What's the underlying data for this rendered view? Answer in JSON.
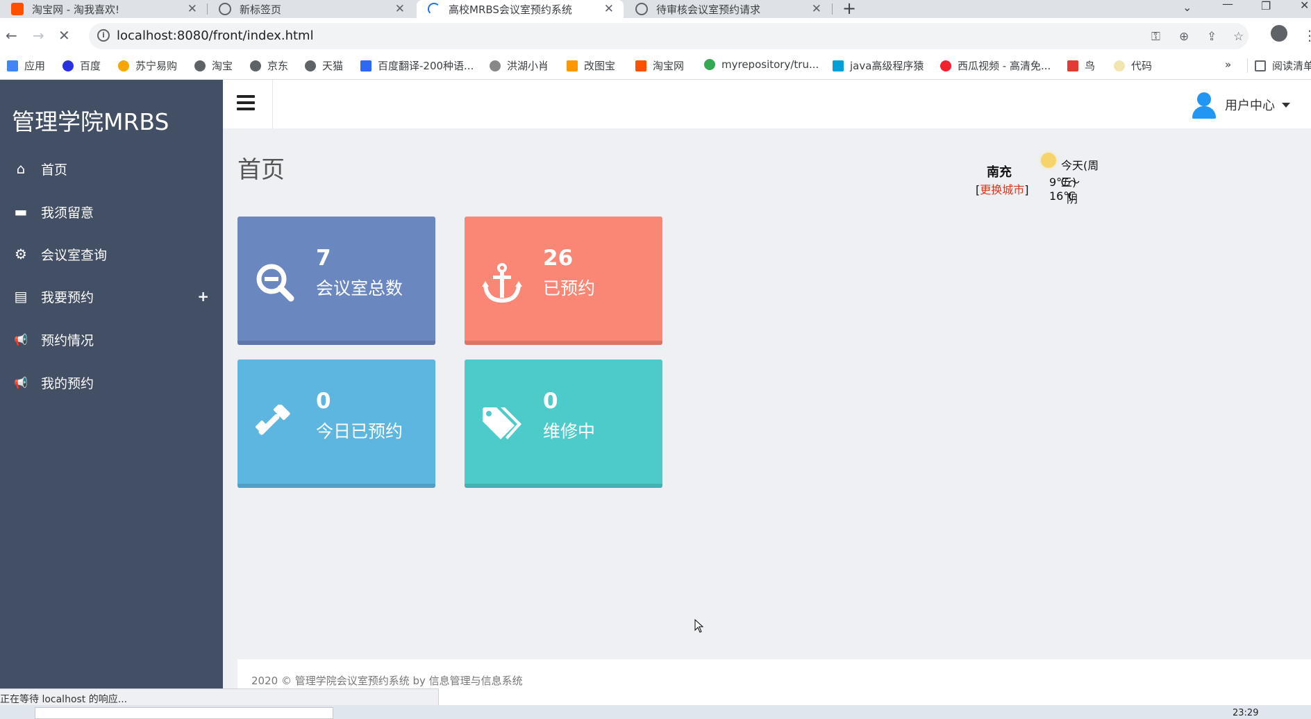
{
  "browser": {
    "tabs": [
      {
        "title": "淘宝网 - 淘我喜欢!",
        "active": false
      },
      {
        "title": "新标签页",
        "active": false
      },
      {
        "title": "高校MRBS会议室预约系统",
        "active": true
      },
      {
        "title": "待审核会议室预约请求",
        "active": false
      }
    ],
    "url": "localhost:8080/front/index.html",
    "bookmarks": [
      {
        "label": "应用",
        "color": "#4285f4"
      },
      {
        "label": "百度",
        "color": "#2932e1"
      },
      {
        "label": "苏宁易购",
        "color": "#f7a600"
      },
      {
        "label": "淘宝",
        "color": "#5f6368"
      },
      {
        "label": "京东",
        "color": "#5f6368"
      },
      {
        "label": "天猫",
        "color": "#5f6368"
      },
      {
        "label": "百度翻译-200种语...",
        "color": "#2a6bf2"
      },
      {
        "label": "洪湖小肖",
        "color": "#888888"
      },
      {
        "label": "改图宝",
        "color": "#ff9800"
      },
      {
        "label": "淘宝网",
        "color": "#ff5000"
      },
      {
        "label": "myrepository/tru...",
        "color": "#34a853"
      },
      {
        "label": "java高级程序猿",
        "color": "#00a1d6"
      },
      {
        "label": "西瓜视频 - 高清免...",
        "color": "#f5222d"
      },
      {
        "label": "鸟",
        "color": "#e53935"
      },
      {
        "label": "代码",
        "color": "#f2e6b0"
      }
    ],
    "bookmarks_more": "»",
    "reading_list": "阅读清单",
    "status_text": "正在等待 localhost 的响应..."
  },
  "sidebar": {
    "brand": "管理学院MRBS",
    "items": [
      {
        "label": "首页",
        "icon": "home-icon",
        "glyph": "⌂"
      },
      {
        "label": "我须留意",
        "icon": "archive-icon",
        "glyph": "▬"
      },
      {
        "label": "会议室查询",
        "icon": "gears-icon",
        "glyph": "⚙"
      },
      {
        "label": "我要预约",
        "icon": "file-icon",
        "glyph": "▤",
        "expand": "+"
      },
      {
        "label": "预约情况",
        "icon": "bullhorn-icon",
        "glyph": "📢"
      },
      {
        "label": "我的预约",
        "icon": "bullhorn-icon",
        "glyph": "📢"
      }
    ]
  },
  "topbar": {
    "user_center": "用户中心"
  },
  "main": {
    "title": "首页",
    "weather": {
      "city": "南充",
      "change_city": "更换城市",
      "day": "今天(周五)",
      "temp": "9℃～16℃",
      "condition": "阴"
    },
    "cards": [
      {
        "value": "7",
        "label": "会议室总数",
        "icon": "search-minus-icon",
        "color": "#6b87c0"
      },
      {
        "value": "26",
        "label": "已预约",
        "icon": "anchor-icon",
        "color": "#fa8775"
      },
      {
        "value": "0",
        "label": "今日已预约",
        "icon": "gavel-icon",
        "color": "#5db6e0"
      },
      {
        "value": "0",
        "label": "维修中",
        "icon": "tags-icon",
        "color": "#4dcbcb"
      }
    ],
    "footer": "2020 © 管理学院会议室预约系统 by 信息管理与信息系统"
  },
  "taskbar": {
    "clock": "23:29"
  }
}
